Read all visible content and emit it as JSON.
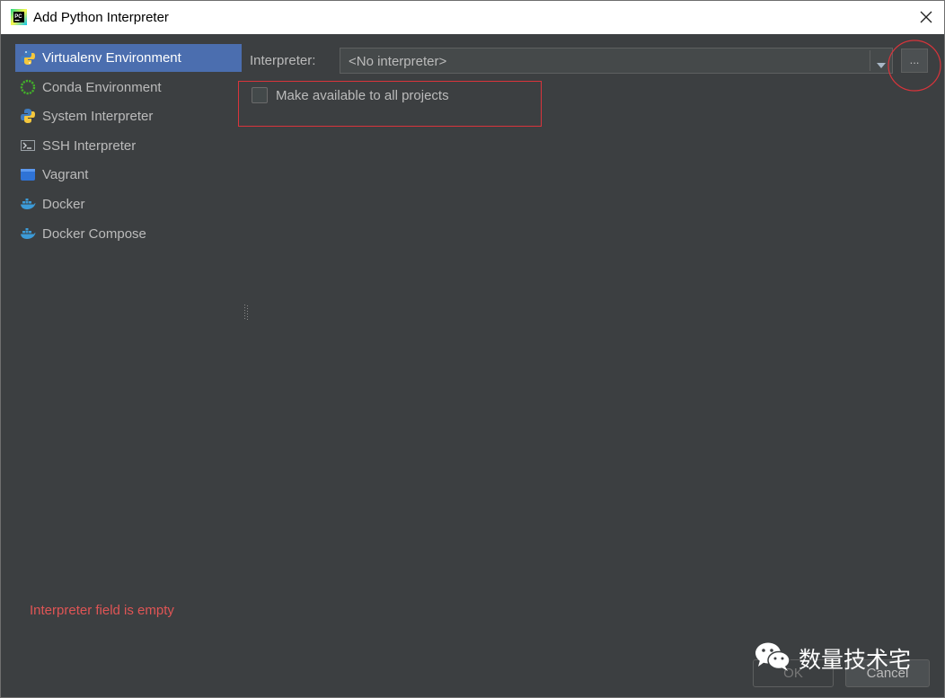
{
  "window": {
    "title": "Add Python Interpreter",
    "app_icon": "pycharm-icon",
    "close_icon": "close-icon"
  },
  "sidebar": {
    "items": [
      {
        "label": "Virtualenv Environment",
        "icon": "python-virtualenv-icon",
        "selected": true
      },
      {
        "label": "Conda Environment",
        "icon": "conda-icon",
        "selected": false
      },
      {
        "label": "System Interpreter",
        "icon": "python-icon",
        "selected": false
      },
      {
        "label": "SSH Interpreter",
        "icon": "terminal-icon",
        "selected": false
      },
      {
        "label": "Vagrant",
        "icon": "vagrant-icon",
        "selected": false
      },
      {
        "label": "Docker",
        "icon": "docker-icon",
        "selected": false
      },
      {
        "label": "Docker Compose",
        "icon": "docker-compose-icon",
        "selected": false
      }
    ]
  },
  "main": {
    "interpreter_label": "Interpreter:",
    "interpreter_value": "<No interpreter>",
    "browse_label": "...",
    "make_available_label": "Make available to all projects",
    "make_available_checked": false,
    "error_text": "Interpreter field is empty"
  },
  "buttons": {
    "ok": "OK",
    "cancel": "Cancel"
  },
  "watermark": {
    "text": "数量技术宅"
  },
  "colors": {
    "background": "#3c3f41",
    "selection": "#4b6eaf",
    "error": "#e05555",
    "annotation": "#d9343b"
  }
}
